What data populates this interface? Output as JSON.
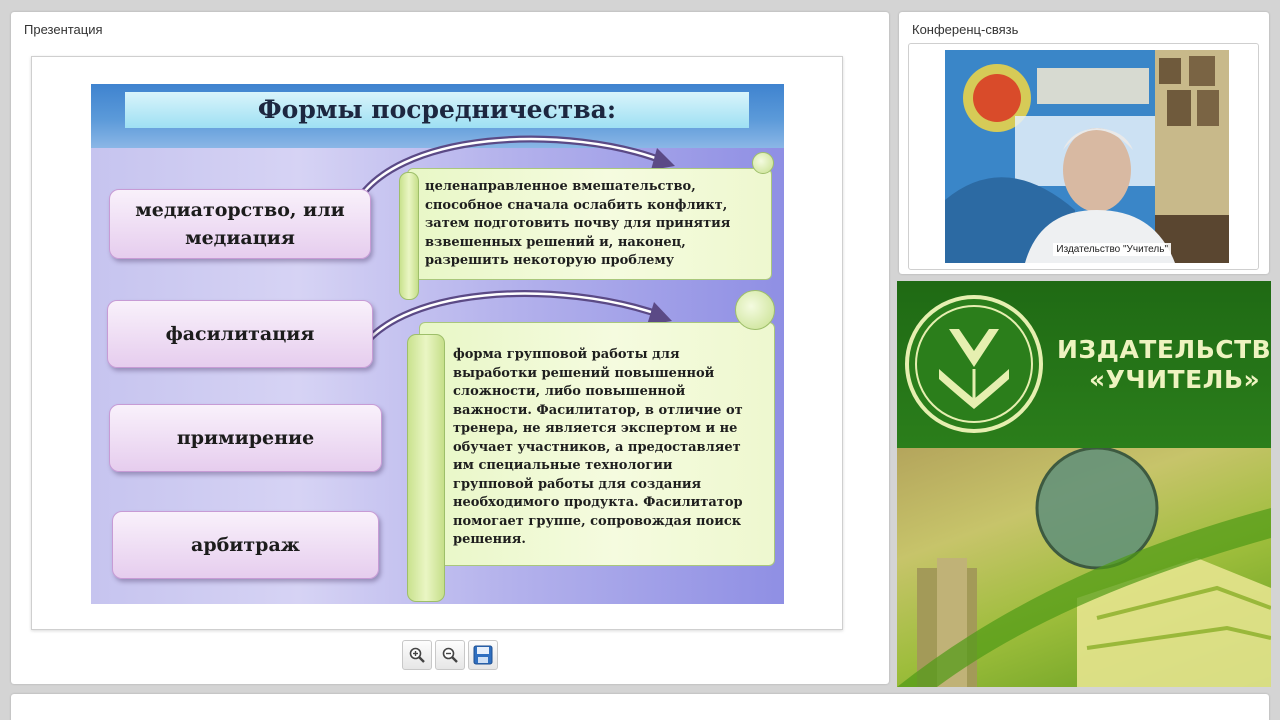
{
  "presentation": {
    "title": "Презентация",
    "slide": {
      "title": "Формы  посредничества:",
      "terms": [
        {
          "label": "медиаторство, или медиация"
        },
        {
          "label": "фасилитация"
        },
        {
          "label": "примирение"
        },
        {
          "label": "арбитраж"
        }
      ],
      "definitions": [
        {
          "text": "целенаправленное вмешательство, способное сначала ослабить конфликт, затем подготовить почву для принятия взвешенных решений и, наконец, разрешить некоторую проблему"
        },
        {
          "text": "форма групповой работы для выработки решений повышенной сложности, либо повышенной важности. Фасилитатор, в отличие от тренера, не является экспертом и не обучает участников, а предоставляет им специальные технологии групповой работы для создания необходимого продукта. Фасилитатор помогает группе, сопровождая поиск решения."
        }
      ]
    },
    "toolbar": {
      "zoom_in": "zoom-in-icon",
      "zoom_out": "zoom-out-icon",
      "save": "save-icon"
    }
  },
  "conference": {
    "title": "Конференц-связь",
    "participant_label": "Издательство \"Учитель\""
  },
  "publisher": {
    "name_line1": "ИЗДАТЕЛЬСТВО",
    "name_line2": "«УЧИТЕЛЬ»"
  },
  "colors": {
    "slide_header": "#3f83cf",
    "term_box": "#e6cdee",
    "scroll": "#eef8cf",
    "publisher_green": "#2b7e1b"
  }
}
